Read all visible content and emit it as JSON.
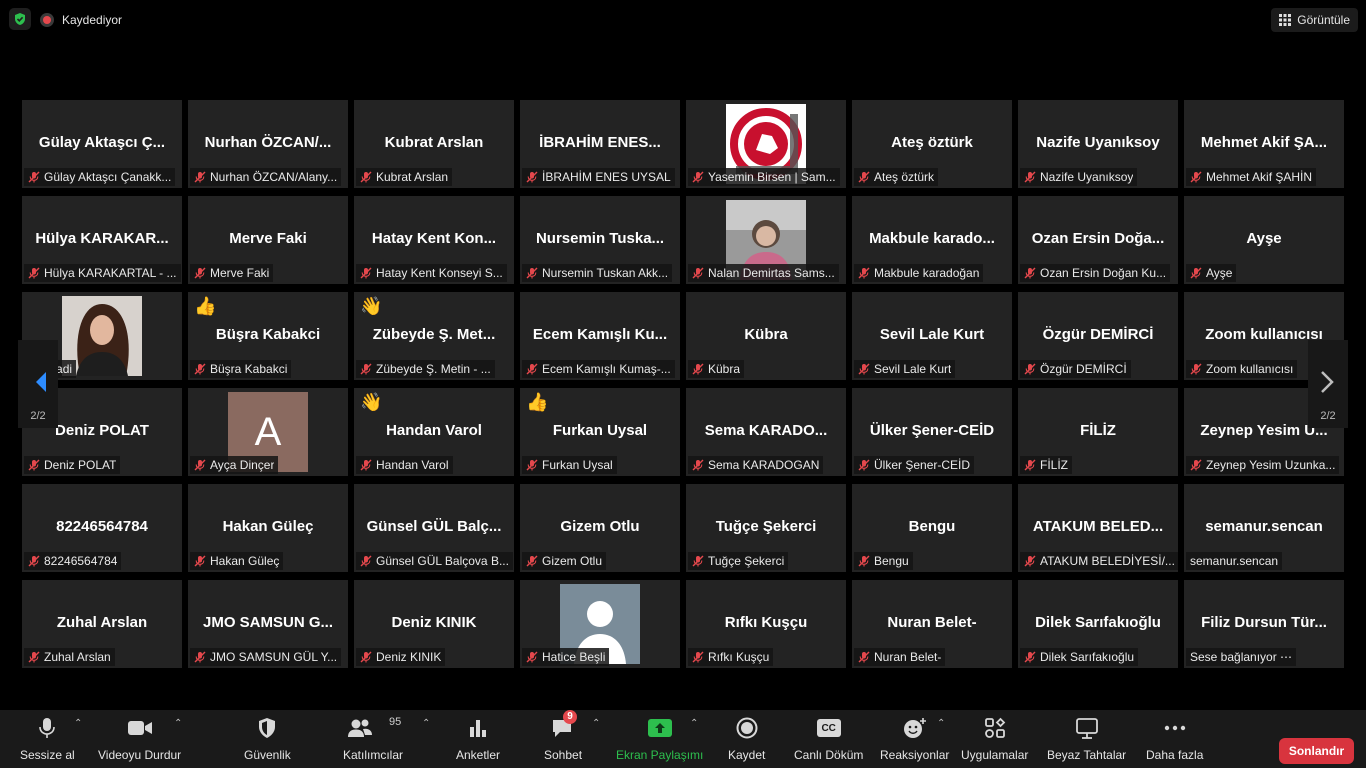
{
  "topbar": {
    "recording_label": "Kaydediyor",
    "view_label": "Görüntüle"
  },
  "pagination": {
    "left": "2/2",
    "right": "2/2"
  },
  "tiles": [
    {
      "big": "Gülay Aktaşcı Ç...",
      "label": "Gülay Aktaşcı Çanakk...",
      "muted": true
    },
    {
      "big": "Nurhan ÖZCAN/...",
      "label": "Nurhan ÖZCAN/Alany...",
      "muted": true
    },
    {
      "big": "Kubrat Arslan",
      "label": "Kubrat Arslan",
      "muted": true
    },
    {
      "big": "İBRAHİM ENES...",
      "label": "İBRAHİM ENES UYSAL",
      "muted": true
    },
    {
      "big": "",
      "label": "Yasemin Birsen | Sam...",
      "muted": true,
      "photo": "chamber-logo"
    },
    {
      "big": "Ateş öztürk",
      "label": "Ateş öztürk",
      "muted": true
    },
    {
      "big": "Nazife Uyanıksoy",
      "label": "Nazife Uyanıksoy",
      "muted": true
    },
    {
      "big": "Mehmet Akif ŞA...",
      "label": "Mehmet Akif ŞAHİN",
      "muted": true
    },
    {
      "big": "Hülya KARAKAR...",
      "label": "Hülya KARAKARTAL - ...",
      "muted": true
    },
    {
      "big": "Merve Faki",
      "label": "Merve Faki",
      "muted": true
    },
    {
      "big": "Hatay Kent Kon...",
      "label": "Hatay Kent Konseyi S...",
      "muted": true
    },
    {
      "big": "Nursemin Tuska...",
      "label": "Nursemin Tuskan Akk...",
      "muted": true
    },
    {
      "big": "",
      "label": "Nalan Demirtas Sams...",
      "muted": true,
      "photo": "person-photo"
    },
    {
      "big": "Makbule karado...",
      "label": "Makbule karadoğan",
      "muted": true
    },
    {
      "big": "Ozan Ersin Doğa...",
      "label": "Ozan Ersin Doğan Ku...",
      "muted": true
    },
    {
      "big": "Ayşe",
      "label": "Ayşe",
      "muted": true
    },
    {
      "big": "",
      "label": "Bagdadi",
      "muted": false,
      "photo": "person-photo-woman"
    },
    {
      "big": "Büşra Kabakci",
      "label": "Büşra Kabakci",
      "muted": true,
      "emoji": "👍"
    },
    {
      "big": "Zübeyde Ş.  Met...",
      "label": "Zübeyde Ş.  Metin - ...",
      "muted": true,
      "emoji": "👋"
    },
    {
      "big": "Ecem Kamışlı Ku...",
      "label": "Ecem Kamışlı Kumaş-...",
      "muted": true
    },
    {
      "big": "Kübra",
      "label": "Kübra",
      "muted": true
    },
    {
      "big": "Sevil Lale Kurt",
      "label": "Sevil Lale Kurt",
      "muted": true
    },
    {
      "big": "Özgür DEMİRCİ",
      "label": "Özgür DEMİRCİ",
      "muted": true
    },
    {
      "big": "Zoom kullanıcısı",
      "label": "Zoom kullanıcısı",
      "muted": true
    },
    {
      "big": "Deniz POLAT",
      "label": "Deniz POLAT",
      "muted": true
    },
    {
      "big": "",
      "label": "Ayça Dinçer",
      "muted": true,
      "photo": "avatar-letter",
      "avatar_letter": "A"
    },
    {
      "big": "Handan Varol",
      "label": "Handan Varol",
      "muted": true,
      "emoji": "👋"
    },
    {
      "big": "Furkan Uysal",
      "label": "Furkan Uysal",
      "muted": true,
      "emoji": "👍"
    },
    {
      "big": "Sema  KARADO...",
      "label": "Sema KARADOGAN",
      "muted": true
    },
    {
      "big": "Ülker Şener-CEİD",
      "label": "Ülker Şener-CEİD",
      "muted": true
    },
    {
      "big": "FİLİZ",
      "label": "FİLİZ",
      "muted": true
    },
    {
      "big": "Zeynep Yesim U...",
      "label": "Zeynep Yesim Uzunka...",
      "muted": true
    },
    {
      "big": "82246564784",
      "label": "82246564784",
      "muted": true
    },
    {
      "big": "Hakan Güleç",
      "label": "Hakan Güleç",
      "muted": true
    },
    {
      "big": "Günsel GÜL Balç...",
      "label": "Günsel GÜL Balçova B...",
      "muted": true
    },
    {
      "big": "Gizem Otlu",
      "label": "Gizem Otlu",
      "muted": true
    },
    {
      "big": "Tuğçe Şekerci",
      "label": "Tuğçe Şekerci",
      "muted": true
    },
    {
      "big": "Bengu",
      "label": "Bengu",
      "muted": true
    },
    {
      "big": "ATAKUM BELED...",
      "label": "ATAKUM BELEDİYESİ/...",
      "muted": true
    },
    {
      "big": "semanur.sencan",
      "label": "semanur.sencan",
      "muted": false
    },
    {
      "big": "Zuhal Arslan",
      "label": "Zuhal Arslan",
      "muted": true
    },
    {
      "big": "JMO SAMSUN G...",
      "label": "JMO SAMSUN GÜL Y...",
      "muted": true
    },
    {
      "big": "Deniz KINIK",
      "label": "Deniz KINIK",
      "muted": true
    },
    {
      "big": "",
      "label": "Hatice Beşli",
      "muted": true,
      "photo": "avatar-default"
    },
    {
      "big": "Rıfkı Kuşçu",
      "label": "Rıfkı Kuşçu",
      "muted": true
    },
    {
      "big": "Nuran Belet-",
      "label": "Nuran Belet-",
      "muted": true
    },
    {
      "big": "Dilek Sarıfakıoğlu",
      "label": "Dilek Sarıfakıoğlu",
      "muted": true
    },
    {
      "big": "Filiz Dursun Tür...",
      "label": "Sese bağlanıyor ⋯",
      "muted": false
    }
  ],
  "toolbar": {
    "mute": "Sessize al",
    "video": "Videoyu Durdur",
    "security": "Güvenlik",
    "participants": "Katılımcılar",
    "participants_count": "95",
    "polls": "Anketler",
    "chat": "Sohbet",
    "chat_badge": "9",
    "share": "Ekran Paylaşımı",
    "record": "Kaydet",
    "captions": "Canlı Döküm",
    "captions_icon_text": "CC",
    "reactions": "Reaksiyonlar",
    "apps": "Uygulamalar",
    "whiteboards": "Beyaz Tahtalar",
    "more": "Daha fazla",
    "end": "Sonlandır"
  },
  "colors": {
    "share_green": "#2dbf4e",
    "end_red": "#d8343e",
    "mute_red": "#e5484d"
  }
}
